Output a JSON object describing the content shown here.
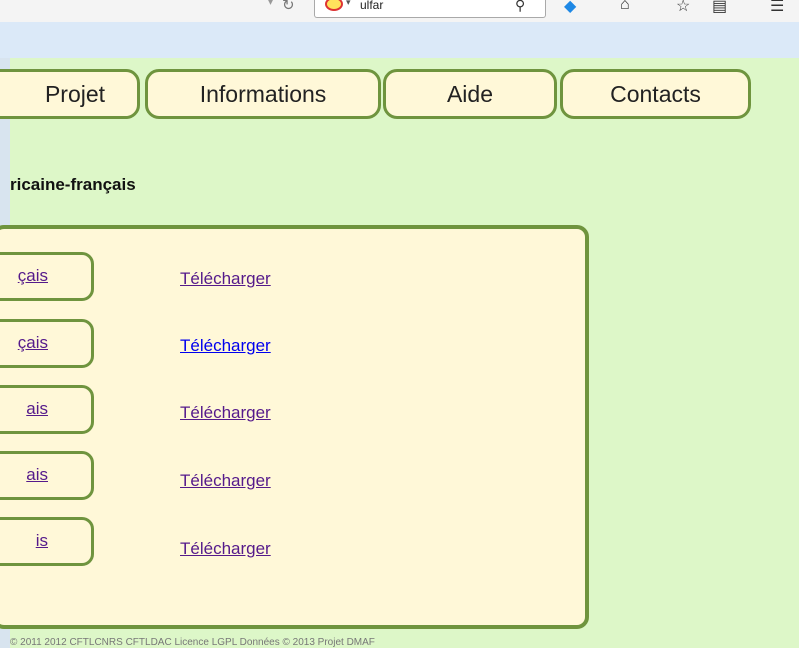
{
  "browser": {
    "url_text": "ulfar"
  },
  "nav": {
    "tabs": [
      {
        "label": "Projet"
      },
      {
        "label": "Informations"
      },
      {
        "label": "Aide"
      },
      {
        "label": "Contacts"
      }
    ]
  },
  "page": {
    "heading": "ricaine-français"
  },
  "downloads": {
    "rows": [
      {
        "language_label": "çais",
        "download_label": "Télécharger",
        "visited": true
      },
      {
        "language_label": "çais",
        "download_label": "Télécharger",
        "visited": false
      },
      {
        "language_label": "ais",
        "download_label": "Télécharger",
        "visited": true
      },
      {
        "language_label": "ais",
        "download_label": "Télécharger",
        "visited": true
      },
      {
        "language_label": "is",
        "download_label": "Télécharger",
        "visited": true
      }
    ]
  },
  "footer": {
    "text": "© 2011 2012 CFTLCNRS CFTLDAC Licence LGPL  Données © 2013 Projet DMAF"
  },
  "colors": {
    "background": "#ddf7c8",
    "panel_fill": "#fff8d8",
    "border_green": "#6f943e",
    "visited_link": "#551a8b",
    "unvisited_link": "#0000ee"
  },
  "icons": [
    "reload-icon",
    "site-identity-icon",
    "search-icon",
    "pocket-icon",
    "home-icon",
    "bookmark-star-icon",
    "library-icon",
    "menu-icon"
  ]
}
